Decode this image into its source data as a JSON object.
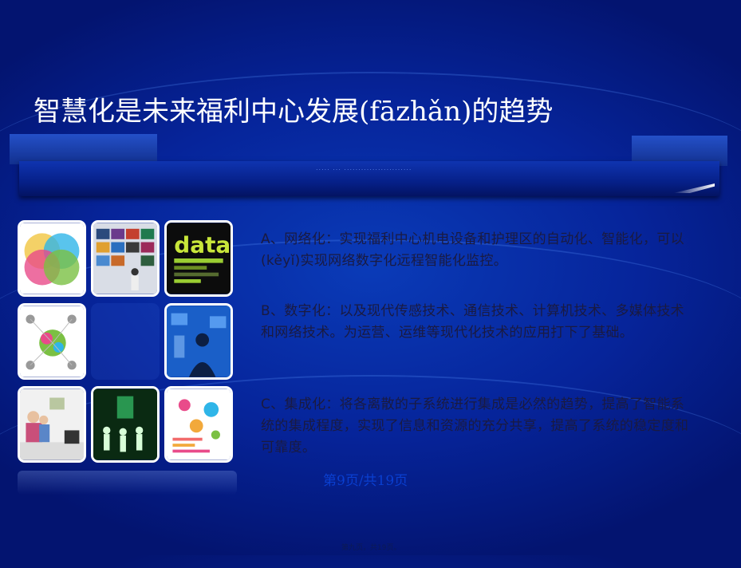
{
  "slide": {
    "title": "智慧化是未来福利中心发展(fāzhǎn)的趋势",
    "paragraphs": [
      "A、网络化：实现福利中心机电设备和护理区的自动化、智能化，可以(kěyǐ)实现网络数字化远程智能化监控。",
      "B、数字化：以及现代传感技术、通信技术、计算机技术、多媒体技术和网络技术。为运营、运维等现代化技术的应用打下了基础。",
      "C、集成化：将各离散的子系统进行集成是必然的趋势，提高了智能系统的集成程度，实现了信息和资源的充分共享，提高了系统的稳定度和可靠度。"
    ],
    "page_indicator": "第9页/共19页",
    "footer": "第九页，共19页。"
  },
  "images": [
    {
      "name": "venn-diagram-image"
    },
    {
      "name": "video-wall-image"
    },
    {
      "name": "data-visualization-image",
      "text": "data"
    },
    {
      "name": "network-diagram-image"
    },
    {
      "name": "empty-tile"
    },
    {
      "name": "digital-person-image"
    },
    {
      "name": "smart-home-image"
    },
    {
      "name": "digital-crowd-image"
    },
    {
      "name": "infographic-image"
    }
  ],
  "colors": {
    "background": "#06249a",
    "title_text": "#ffffff",
    "body_text": "#1a1a40",
    "page_indicator": "#0a3fd0"
  }
}
